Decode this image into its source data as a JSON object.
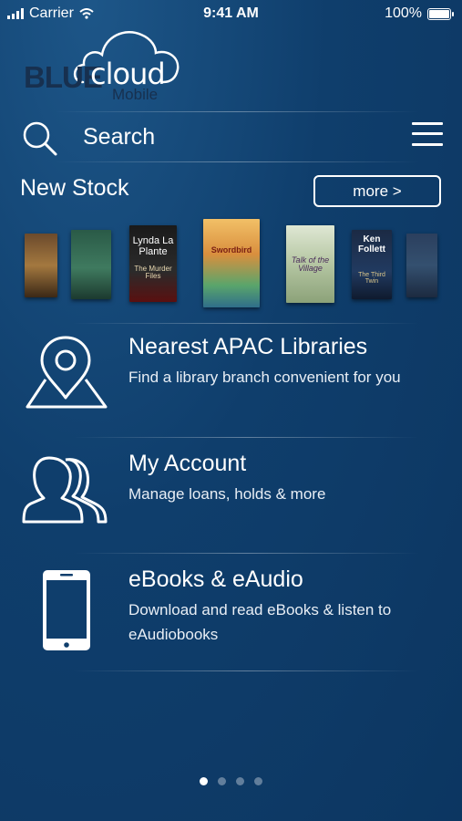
{
  "status_bar": {
    "carrier": "Carrier",
    "time": "9:41 AM",
    "battery": "100%"
  },
  "logo": {
    "blue": "BLUE",
    "cloud": "cloud",
    "mobile": "Mobile"
  },
  "search": {
    "label": "Search"
  },
  "new_stock": {
    "title": "New Stock",
    "more_label": "more >",
    "books": [
      {
        "title": ""
      },
      {
        "title": ""
      },
      {
        "author": "Lynda La Plante",
        "title": "The Murder Files"
      },
      {
        "title": "Swordbird"
      },
      {
        "title": "Talk of the Village"
      },
      {
        "author": "Ken Follett",
        "title": "The Third Twin"
      },
      {
        "title": ""
      }
    ]
  },
  "menu": [
    {
      "title": "Nearest APAC Libraries",
      "subtitle": "Find a library branch convenient for you"
    },
    {
      "title": "My Account",
      "subtitle": "Manage loans, holds & more"
    },
    {
      "title": "eBooks & eAudio",
      "subtitle": "Download and read eBooks & listen to eAudiobooks"
    }
  ],
  "pagination": {
    "pages": 4,
    "active": 1
  },
  "colors": {
    "background": "#0f3e6c",
    "logo_dark": "#17304f"
  }
}
